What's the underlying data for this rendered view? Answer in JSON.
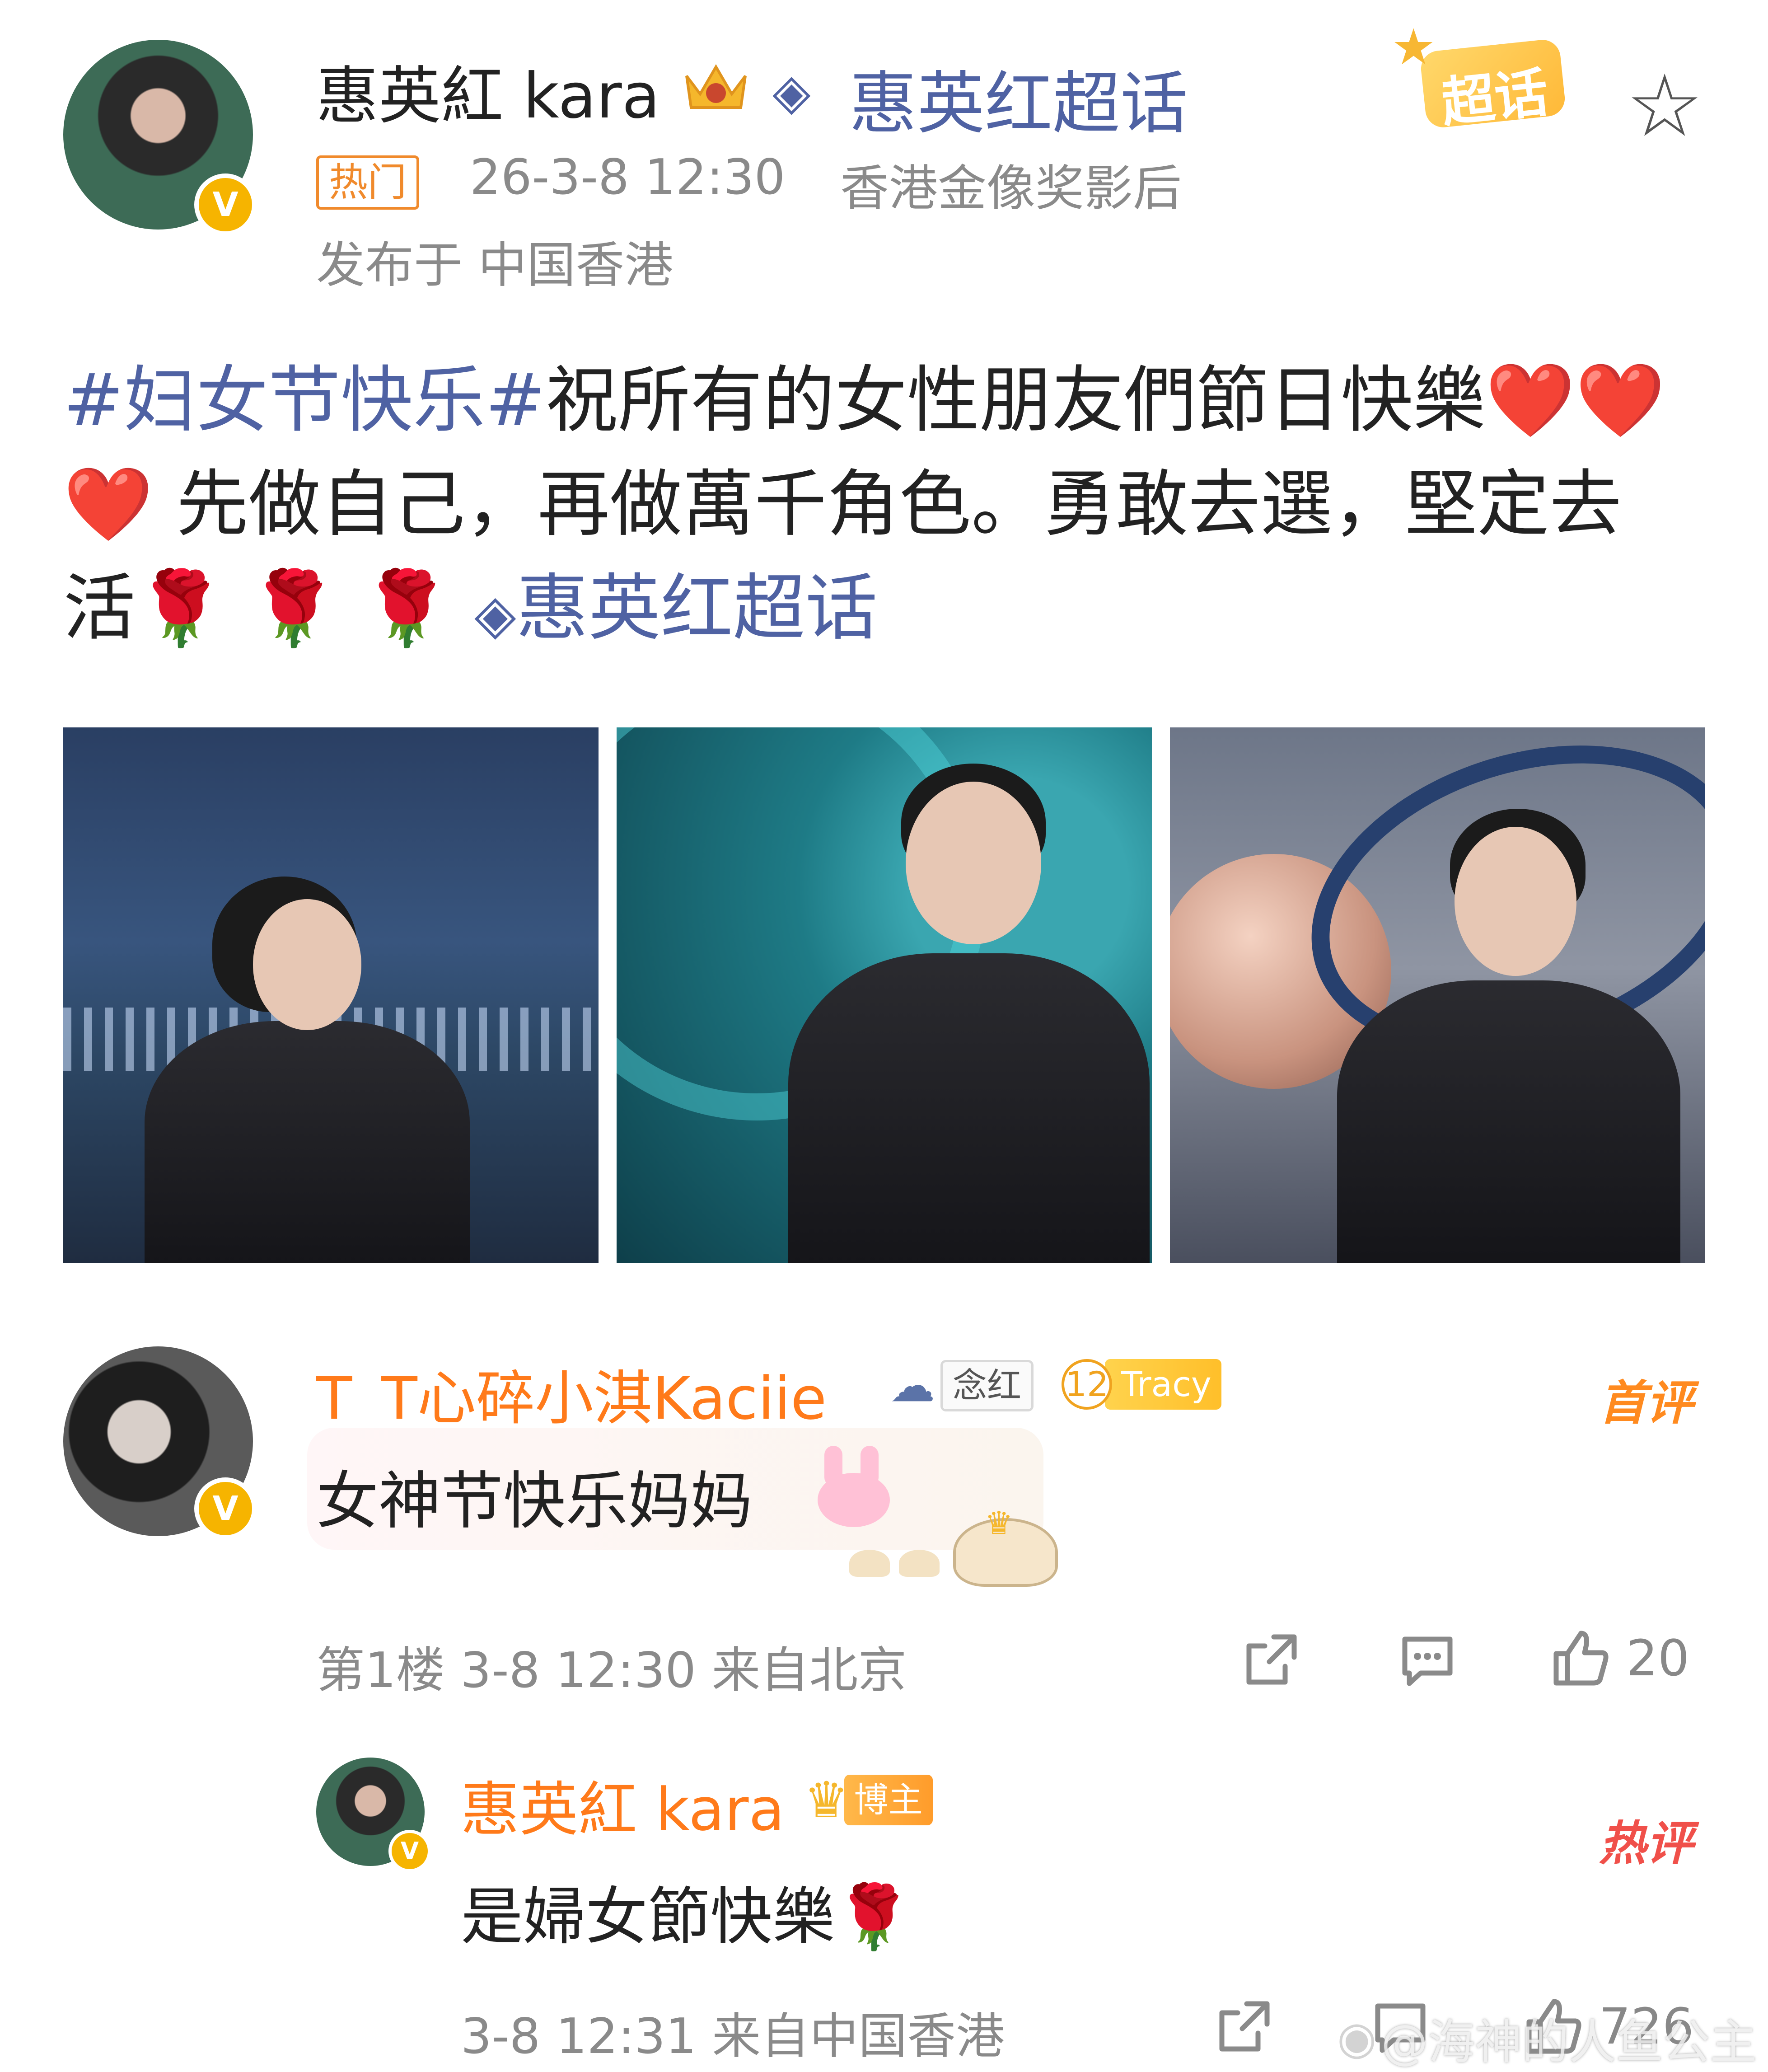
{
  "post": {
    "author": "惠英紅 kara",
    "supertopic_link": "惠英红超话",
    "hot_tag": "热门",
    "datetime": "26-3-8 12:30",
    "author_title": "香港金像奖影后",
    "location": "发布于 中国香港",
    "supertopic_badge": "超话",
    "hashtag": "#妇女节快乐#",
    "text_line1": "祝所有的女性朋友們節日快樂❤️❤️",
    "text_line2": "❤️ 先做自己，再做萬千角色。勇敢去選，堅定去",
    "text_line3": "活🌹 🌹 🌹",
    "text_supertopic": "惠英红超话",
    "image_count": 3
  },
  "comment1": {
    "user": "T_T心碎小淇Kaciie",
    "badge_fan": "念红",
    "badge_level": "12",
    "badge_name": "Tracy",
    "tag": "首评",
    "text": "女神节快乐妈妈",
    "floor": "第1楼 3-8 12:30 来自北京",
    "likes": "20"
  },
  "reply1": {
    "user": "惠英紅 kara",
    "badge": "博主",
    "tag": "热评",
    "text": "是婦女節快樂🌹",
    "meta": "3-8 12:31 来自中国香港",
    "likes": "726"
  },
  "watermark": "@海神的人鱼公主",
  "colors": {
    "link_blue": "#4f62a3",
    "accent_orange": "#ff7a1a",
    "verified_yellow": "#f6b400",
    "hot_red": "#f0504a"
  }
}
